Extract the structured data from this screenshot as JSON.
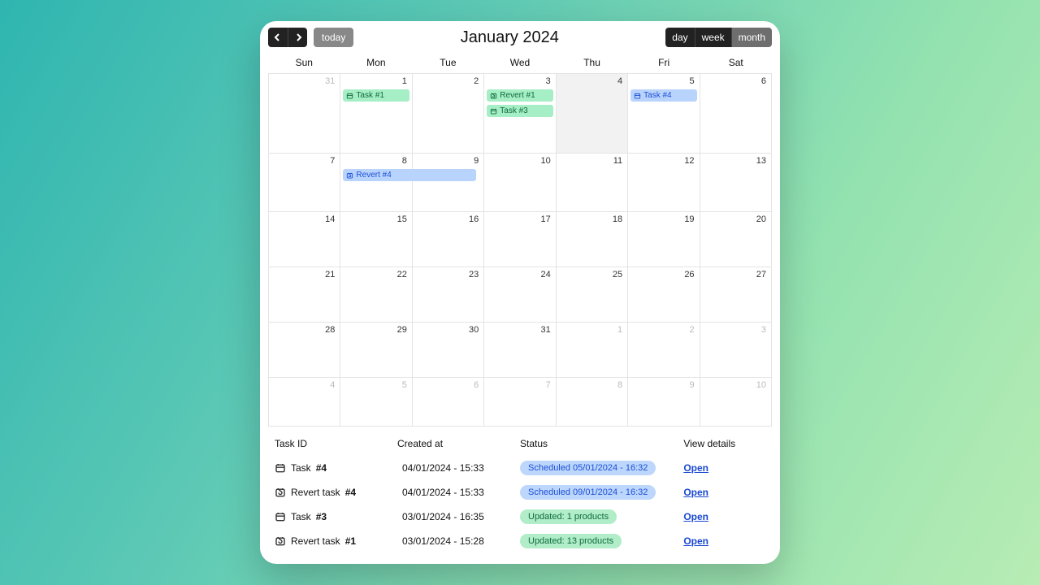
{
  "toolbar": {
    "today_label": "today",
    "title": "January 2024",
    "views": {
      "day": "day",
      "week": "week",
      "month": "month"
    },
    "active_view": "month"
  },
  "days_of_week": [
    "Sun",
    "Mon",
    "Tue",
    "Wed",
    "Thu",
    "Fri",
    "Sat"
  ],
  "weeks": [
    {
      "cells": [
        {
          "d": "31",
          "muted": true,
          "events": []
        },
        {
          "d": "1",
          "events": [
            {
              "label": "Task #1",
              "color": "green",
              "icon": "cal"
            }
          ]
        },
        {
          "d": "2",
          "events": []
        },
        {
          "d": "3",
          "events": [
            {
              "label": "Revert #1",
              "color": "green",
              "icon": "revert"
            },
            {
              "label": "Task #3",
              "color": "green",
              "icon": "cal"
            }
          ]
        },
        {
          "d": "4",
          "today": true,
          "events": []
        },
        {
          "d": "5",
          "events": [
            {
              "label": "Task #4",
              "color": "blue",
              "icon": "cal"
            }
          ]
        },
        {
          "d": "6",
          "events": []
        }
      ]
    },
    {
      "cells": [
        {
          "d": "7",
          "events": []
        },
        {
          "d": "8",
          "events": []
        },
        {
          "d": "9",
          "events": [
            {
              "label": "Revert #4",
              "color": "blue",
              "icon": "revert",
              "span_left": true
            }
          ]
        },
        {
          "d": "10",
          "events": []
        },
        {
          "d": "11",
          "events": []
        },
        {
          "d": "12",
          "events": []
        },
        {
          "d": "13",
          "events": []
        }
      ]
    },
    {
      "cells": [
        {
          "d": "14"
        },
        {
          "d": "15"
        },
        {
          "d": "16"
        },
        {
          "d": "17"
        },
        {
          "d": "18"
        },
        {
          "d": "19"
        },
        {
          "d": "20"
        }
      ]
    },
    {
      "cells": [
        {
          "d": "21"
        },
        {
          "d": "22"
        },
        {
          "d": "23"
        },
        {
          "d": "24"
        },
        {
          "d": "25"
        },
        {
          "d": "26"
        },
        {
          "d": "27"
        }
      ]
    },
    {
      "cells": [
        {
          "d": "28"
        },
        {
          "d": "29"
        },
        {
          "d": "30"
        },
        {
          "d": "31"
        },
        {
          "d": "1",
          "muted": true
        },
        {
          "d": "2",
          "muted": true
        },
        {
          "d": "3",
          "muted": true
        }
      ]
    },
    {
      "cells": [
        {
          "d": "4",
          "muted": true
        },
        {
          "d": "5",
          "muted": true
        },
        {
          "d": "6",
          "muted": true
        },
        {
          "d": "7",
          "muted": true
        },
        {
          "d": "8",
          "muted": true
        },
        {
          "d": "9",
          "muted": true
        },
        {
          "d": "10",
          "muted": true
        }
      ]
    }
  ],
  "task_table": {
    "headers": {
      "id": "Task ID",
      "created": "Created at",
      "status": "Status",
      "details": "View details"
    },
    "open_label": "Open",
    "rows": [
      {
        "icon": "cal",
        "name": "Task",
        "num": "#4",
        "created": "04/01/2024 - 15:33",
        "status": "Scheduled 05/01/2024 - 16:32",
        "status_color": "blue"
      },
      {
        "icon": "revert",
        "name": "Revert task",
        "num": "#4",
        "created": "04/01/2024 - 15:33",
        "status": "Scheduled 09/01/2024 - 16:32",
        "status_color": "blue"
      },
      {
        "icon": "cal",
        "name": "Task",
        "num": "#3",
        "created": "03/01/2024 - 16:35",
        "status": "Updated: 1 products",
        "status_color": "green"
      },
      {
        "icon": "revert",
        "name": "Revert task",
        "num": "#1",
        "created": "03/01/2024 - 15:28",
        "status": "Updated: 13 products",
        "status_color": "green"
      }
    ]
  }
}
